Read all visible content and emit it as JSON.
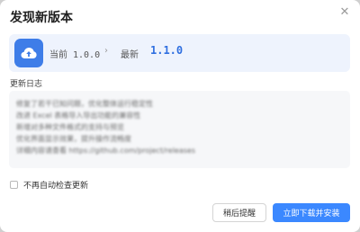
{
  "dialog": {
    "title": "发现新版本",
    "close_glyph": "✕"
  },
  "version": {
    "current_label": "当前",
    "current_value": "1.0.0",
    "arrow_glyph": "›",
    "new_label": "最新",
    "new_value": "1.1.0",
    "icon": "cloud-upload-icon",
    "accent_color": "#3e7de8"
  },
  "changelog": {
    "title": "更新日志",
    "lines": [
      "修复了若干已知问题，优化整体运行稳定性",
      "改进 Excel 表格导入导出功能的兼容性",
      "新增对多种文件格式的支持与预览",
      "优化界面显示效果，提升操作流畅度",
      "详细内容请查看 https://github.com/project/releases"
    ]
  },
  "options": {
    "auto_check_label": "不再自动检查更新",
    "auto_check_checked": false
  },
  "actions": {
    "later_label": "稍后提醒",
    "install_label": "立即下载并安装"
  }
}
